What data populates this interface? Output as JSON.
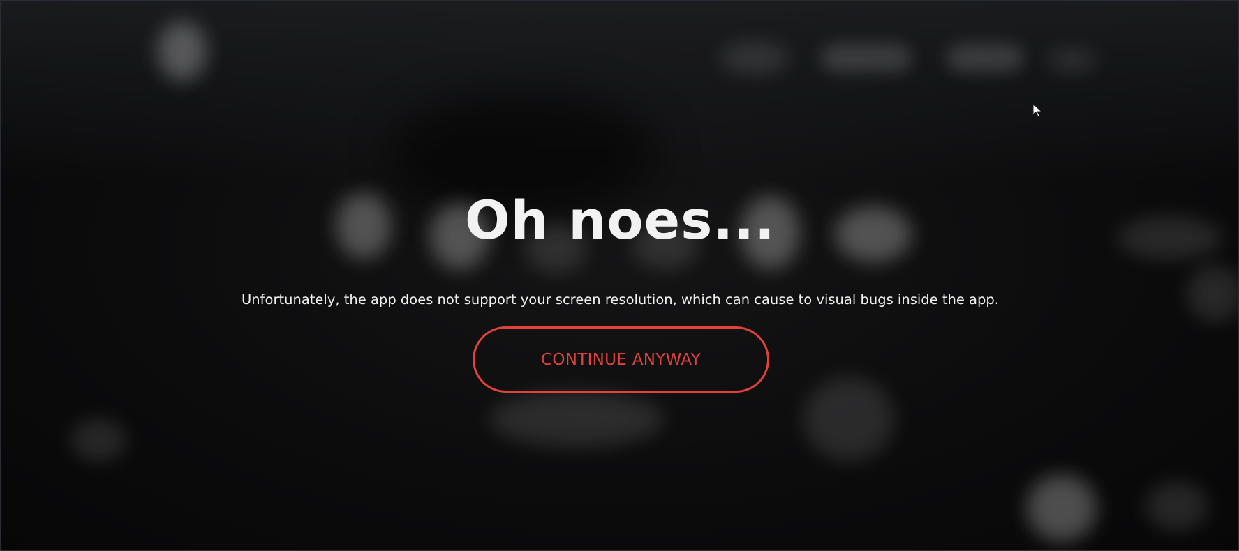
{
  "dialog": {
    "title": "Oh noes...",
    "message": "Unfortunately, the app does not support your screen resolution, which can cause to visual bugs inside the app.",
    "continue_label": "CONTINUE ANYWAY"
  },
  "colors": {
    "accent": "#e0433b",
    "background": "#0b0b0c",
    "text": "#f2f2f2"
  },
  "icons": {
    "cursor": "mouse-pointer-icon"
  }
}
